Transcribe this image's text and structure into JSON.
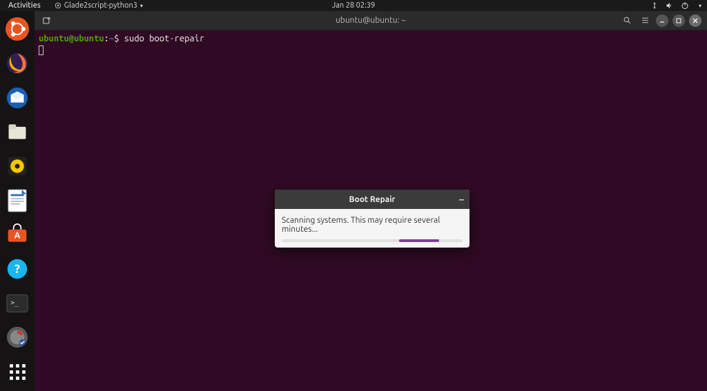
{
  "top_panel": {
    "activities": "Activities",
    "app_name": "Glade2script-python3",
    "datetime": "Jan 28  02:39",
    "tray_icons": [
      "network-icon",
      "volume-icon",
      "power-icon",
      "caret-down-icon"
    ]
  },
  "dock": {
    "items": [
      {
        "name": "ubuntu-logo",
        "color": "#E95420"
      },
      {
        "name": "firefox",
        "color": "#FF7139"
      },
      {
        "name": "thunderbird",
        "color": "#0A84FF"
      },
      {
        "name": "files",
        "color": "#D9D5C9"
      },
      {
        "name": "rhythmbox",
        "color": "#F7C800"
      },
      {
        "name": "libreoffice-writer",
        "color": "#2A74C9"
      },
      {
        "name": "ubuntu-software",
        "color": "#E95420"
      },
      {
        "name": "help",
        "color": "#19B6EE"
      },
      {
        "name": "terminal",
        "color": "#333333"
      },
      {
        "name": "boot-repair",
        "color": "#6E6E6E"
      }
    ],
    "apps_button": "show-applications"
  },
  "terminal": {
    "title": "ubuntu@ubuntu: ~",
    "prompt_userhost": "ubuntu@ubuntu",
    "prompt_sep": ":",
    "prompt_path": "~",
    "prompt_symbol": "$",
    "command": "sudo boot-repair"
  },
  "dialog": {
    "title": "Boot Repair",
    "message": "Scanning systems. This may require several minutes..."
  }
}
